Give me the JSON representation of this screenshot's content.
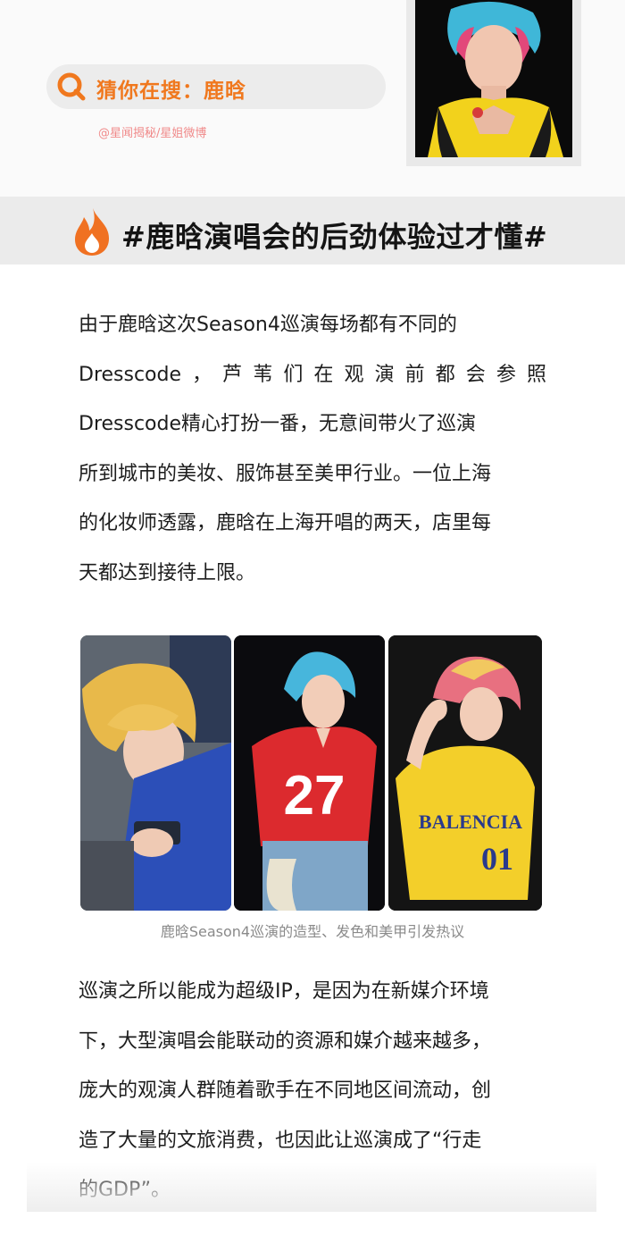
{
  "header": {
    "search_label": "猜你在搜：鹿晗",
    "source_credit": "@星闻揭秘/星姐微博"
  },
  "topic": {
    "title": "#鹿晗演唱会的后劲体验过才懂#"
  },
  "paragraph1": {
    "lines": [
      "由于鹿晗这次Season4巡演每场都有不同的",
      "Dresscode，芦苇们在观演前都会参照",
      "Dresscode精心打扮一番，无意间带火了巡演",
      "所到城市的美妆、服饰甚至美甲行业。一位上海",
      "的化妆师透露，鹿晗在上海开唱的两天，店里每",
      "天都达到接待上限。"
    ]
  },
  "photos": {
    "caption": "鹿晗Season4巡演的造型、发色和美甲引发热议",
    "jersey_number": "27",
    "shirt_text": "BALENCIA",
    "shirt_number": "01"
  },
  "paragraph2": {
    "lines": [
      "巡演之所以能成为超级IP，是因为在新媒介环境",
      "下，大型演唱会能联动的资源和媒介越来越多，",
      "庞大的观演人群随着歌手在不同地区间流动，创",
      "造了大量的文旅消费，也因此让巡演成了“行走",
      "的GDP”。"
    ]
  },
  "colors": {
    "accent_orange": "#f0781e",
    "credit_pink": "#f08a8a",
    "band_gray": "#ebebeb"
  }
}
